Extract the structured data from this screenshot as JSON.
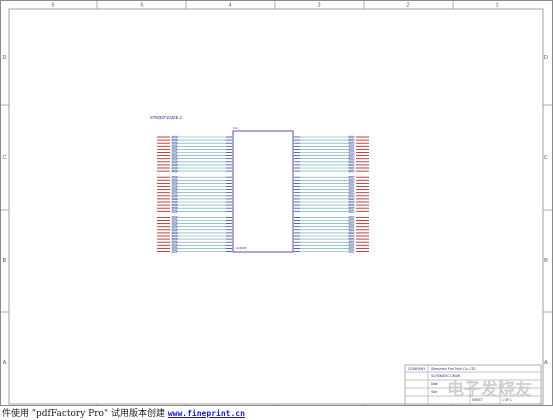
{
  "sheet": {
    "columns": [
      "6",
      "5",
      "4",
      "3",
      "2",
      "1"
    ],
    "rows": [
      "D",
      "C",
      "B",
      "A"
    ]
  },
  "component": {
    "title": "STM32F103ZE.2",
    "pin_prefix": "Vcc",
    "pin_suffix": "GND2B",
    "left_pin_count": 36,
    "right_pin_count": 36
  },
  "title_block": {
    "company_label": "COMPANY",
    "company_value": "Shenzhen Fire Tech Co.,LTD",
    "lines": [
      "SCHEMATIC DRAW",
      "Date",
      "Size"
    ],
    "sheet_label": "SHEET",
    "sheet_value": "1 OF 1"
  },
  "watermark": "电子发烧友",
  "footer": {
    "text_prefix": "件使用 \"pdfFactory Pro\" 试用版本创建",
    "link": "www.fineprint.cn"
  },
  "colors": {
    "frame": "#8a8a8a",
    "wire": "#5f9fb0",
    "pin": "#3a3a9a",
    "label": "#b0302a",
    "component": "#2a2a8a",
    "watermark": "#c8c8c8"
  }
}
